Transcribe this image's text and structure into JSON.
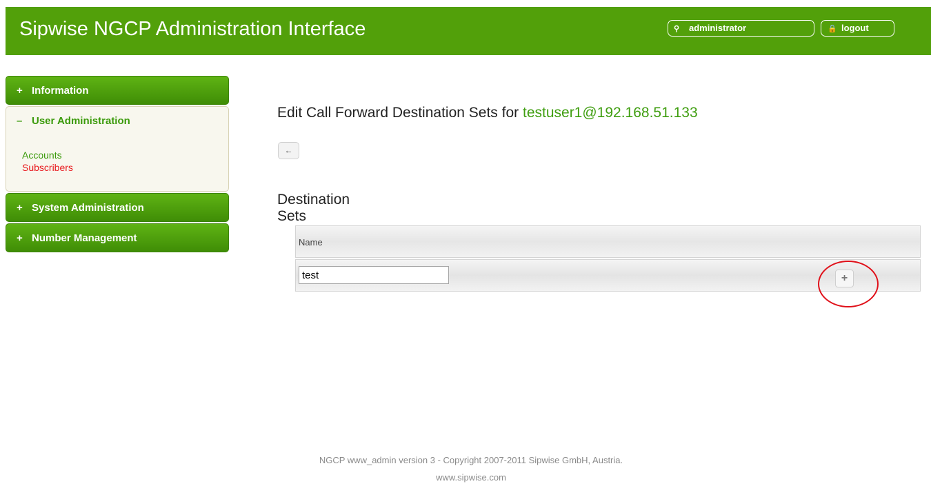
{
  "header": {
    "title": "Sipwise NGCP Administration Interface",
    "user_label": "administrator",
    "logout_label": "logout",
    "brand_color": "#52a00a",
    "user_icon": "user-icon",
    "logout_icon": "lock-icon"
  },
  "sidebar": {
    "items": [
      {
        "label": "Information",
        "sign": "+",
        "expanded": false
      },
      {
        "label": "User Administration",
        "sign": "–",
        "expanded": true,
        "links": [
          {
            "label": "Accounts",
            "active": false
          },
          {
            "label": "Subscribers",
            "active": true
          }
        ]
      },
      {
        "label": "System Administration",
        "sign": "+",
        "expanded": false
      },
      {
        "label": "Number Management",
        "sign": "+",
        "expanded": false
      }
    ]
  },
  "main": {
    "title_prefix": "Edit Call Forward Destination Sets for",
    "title_subject": "testuser1@192.168.51.133",
    "back_icon": "arrow-left-icon",
    "back_glyph": "←",
    "section_title": "Destination Sets",
    "table": {
      "column_header": "Name",
      "new_row_value": "test",
      "add_glyph": "+",
      "add_icon": "plus-icon"
    }
  },
  "footer": {
    "copyright": "NGCP www_admin version 3 - Copyright 2007-2011 Sipwise GmbH, Austria.",
    "website": "www.sipwise.com"
  }
}
